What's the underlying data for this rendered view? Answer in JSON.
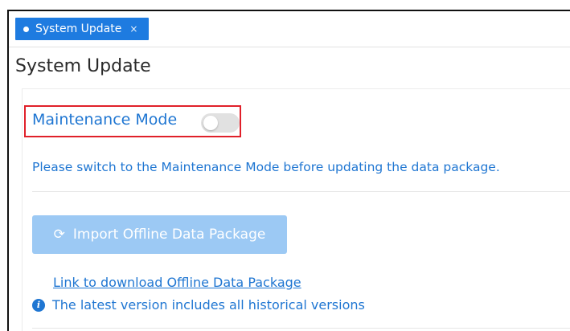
{
  "tab": {
    "label": "System Update",
    "close_glyph": "×"
  },
  "page": {
    "title": "System Update"
  },
  "maintenance": {
    "label": "Maintenance Mode",
    "toggle_on": false,
    "hint": "Please switch to the Maintenance Mode before updating the data package."
  },
  "import": {
    "button_label": "Import Offline Data Package",
    "icon": "refresh-icon"
  },
  "download": {
    "link_text": "Link to download Offline Data Package"
  },
  "info": {
    "text": "The latest version includes all historical versions",
    "icon": "info-icon"
  },
  "colors": {
    "accent": "#1f76d2",
    "tab_bg": "#1e7be0",
    "button_disabled": "#9cc9f4",
    "highlight": "#e0202a"
  }
}
